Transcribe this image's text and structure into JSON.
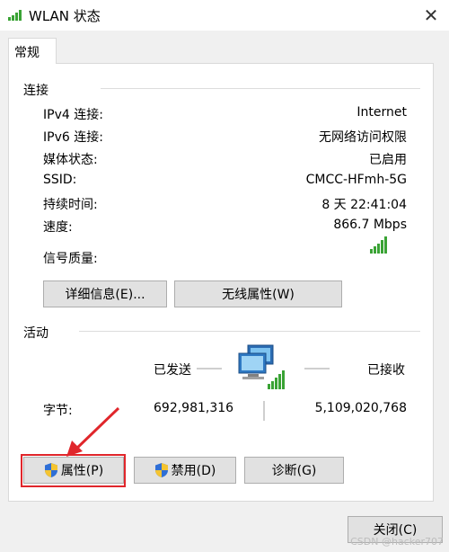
{
  "window": {
    "title": "WLAN 状态",
    "close_glyph": "✕"
  },
  "tabs": [
    {
      "label": "常规"
    }
  ],
  "connection": {
    "group_label": "连接",
    "rows": [
      {
        "label": "IPv4 连接:",
        "value": "Internet"
      },
      {
        "label": "IPv6 连接:",
        "value": "无网络访问权限"
      },
      {
        "label": "媒体状态:",
        "value": "已启用"
      },
      {
        "label": "SSID:",
        "value": "CMCC-HFmh-5G"
      },
      {
        "label": "持续时间:",
        "value": "8 天 22:41:04"
      },
      {
        "label": "速度:",
        "value": "866.7 Mbps"
      }
    ],
    "signal_label": "信号质量:",
    "signal_icon": "signal-bars-icon",
    "details_button": "详细信息(E)...",
    "wireless_button": "无线属性(W)"
  },
  "activity": {
    "group_label": "活动",
    "sent_label": "已发送",
    "received_label": "已接收",
    "bytes_label": "字节:",
    "bytes_sent": "692,981,316",
    "bytes_received": "5,109,020,768",
    "network_icon": "network-computers-icon"
  },
  "actions": {
    "properties_button": "属性(P)",
    "disable_button": "禁用(D)",
    "diagnose_button": "诊断(G)",
    "shield_icon": "uac-shield-icon"
  },
  "footer": {
    "close_button": "关闭(C)"
  },
  "watermark": "CSDN @hacker707",
  "colors": {
    "highlight": "#e0262b",
    "signal_green": "#3aa335"
  }
}
